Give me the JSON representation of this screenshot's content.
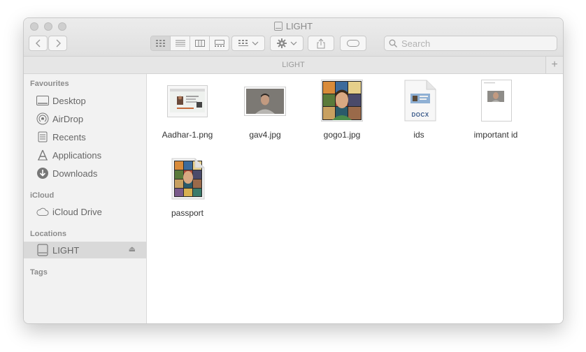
{
  "window": {
    "title": "LIGHT"
  },
  "toolbar": {
    "search_placeholder": "Search"
  },
  "pathbar": {
    "label": "LIGHT",
    "add_label": "+"
  },
  "sidebar": {
    "favourites_header": "Favourites",
    "icloud_header": "iCloud",
    "locations_header": "Locations",
    "tags_header": "Tags",
    "items": [
      {
        "label": "Desktop",
        "icon": "desktop-icon"
      },
      {
        "label": "AirDrop",
        "icon": "airdrop-icon"
      },
      {
        "label": "Recents",
        "icon": "recents-icon"
      },
      {
        "label": "Applications",
        "icon": "applications-icon"
      },
      {
        "label": "Downloads",
        "icon": "downloads-icon"
      },
      {
        "label": "iCloud Drive",
        "icon": "cloud-icon"
      },
      {
        "label": "LIGHT",
        "icon": "drive-icon",
        "eject": "⏏"
      }
    ]
  },
  "files": [
    {
      "name": "Aadhar-1.png",
      "kind": "png-image"
    },
    {
      "name": "gav4.jpg",
      "kind": "jpg-image"
    },
    {
      "name": "gogo1.jpg",
      "kind": "jpg-image"
    },
    {
      "name": "ids",
      "kind": "docx-document",
      "badge": "DOCX"
    },
    {
      "name": "important id",
      "kind": "document"
    },
    {
      "name": "passport",
      "kind": "document"
    }
  ]
}
